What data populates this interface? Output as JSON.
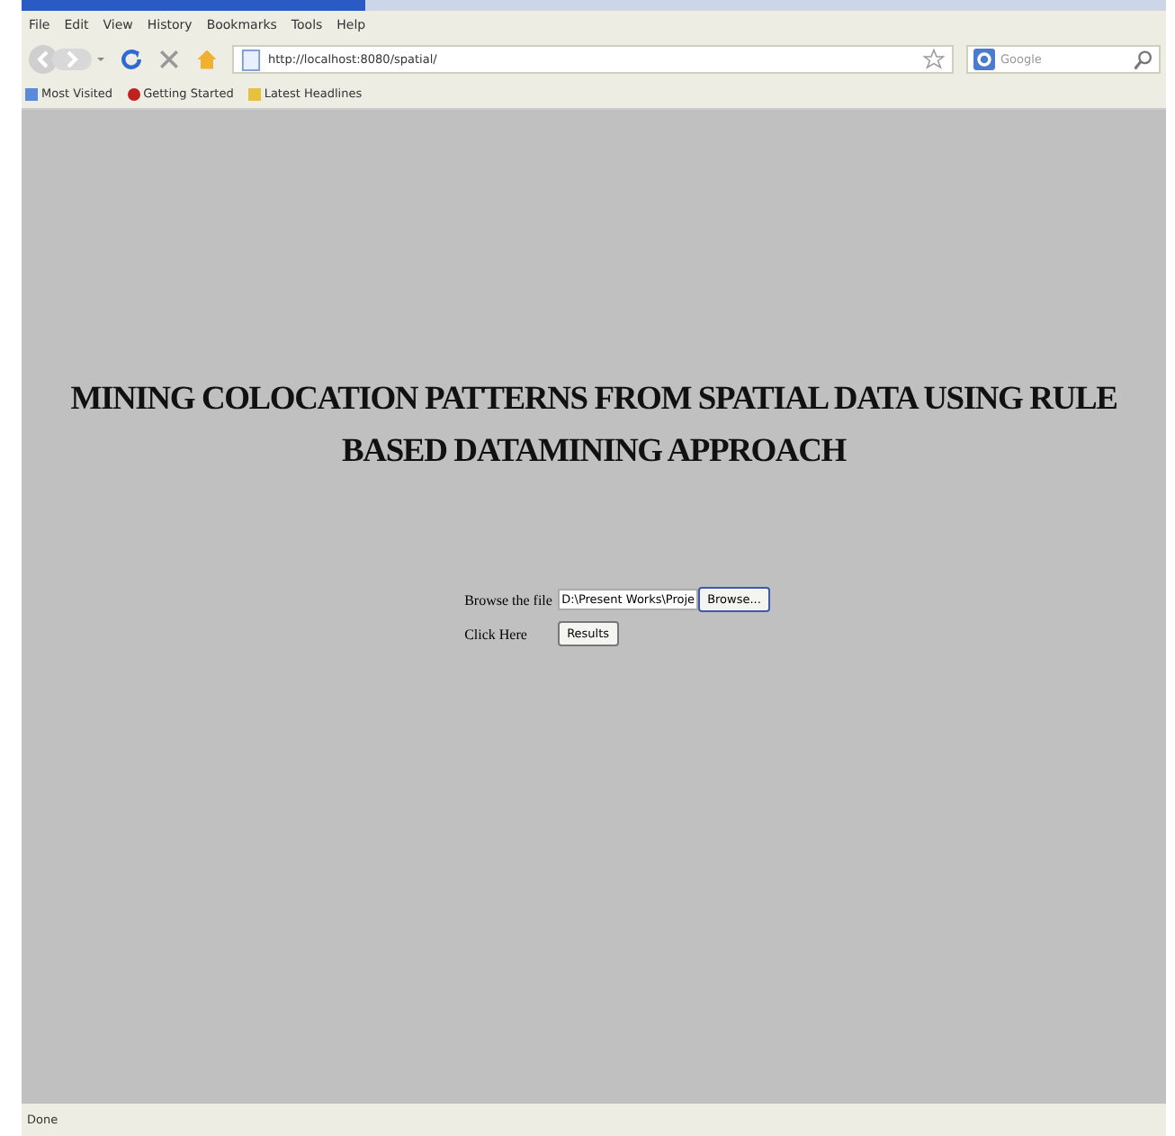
{
  "menu_bar": [
    "File",
    "Edit",
    "View",
    "History",
    "Bookmarks",
    "Tools",
    "Help"
  ],
  "address_bar": {
    "value": "http://localhost:8080/spatial/"
  },
  "search": {
    "placeholder": "Google"
  },
  "bookmarks": [
    "Most Visited",
    "Getting Started",
    "Latest Headlines"
  ],
  "page": {
    "heading": "MINING COLOCATION PATTERNS FROM SPATIAL DATA USING RULE BASED DATAMINING APPROACH",
    "form_rows": [
      {
        "kind": "file",
        "label": "Browse the file",
        "value": "D:\\Present Works\\Proje",
        "button": "Browse..."
      },
      {
        "kind": "button",
        "label": "Click Here",
        "button": "Results"
      }
    ]
  },
  "status_bar": "Done"
}
